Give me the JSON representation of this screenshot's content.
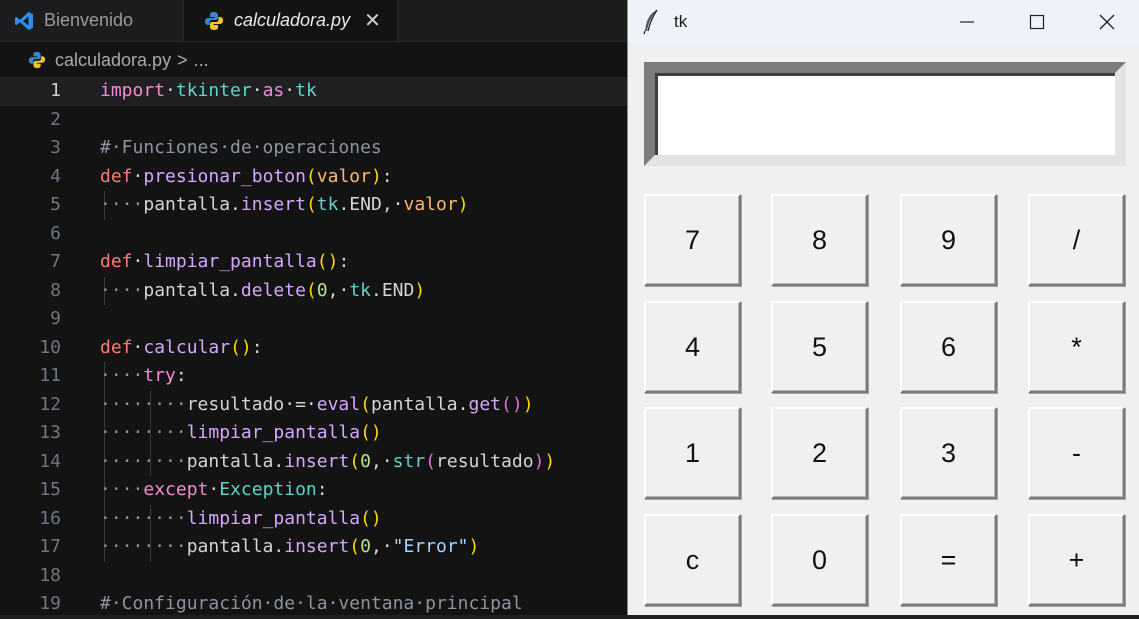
{
  "editor": {
    "tabs": [
      {
        "label": "Bienvenido",
        "icon": "vscode-logo-icon"
      },
      {
        "label": "calculadora.py",
        "icon": "python-icon",
        "close": "✕"
      }
    ],
    "breadcrumb": {
      "file": "calculadora.py",
      "sep": ">",
      "more": "..."
    },
    "lines": [
      {
        "n": "1",
        "indent": 0,
        "toks": [
          [
            "kw",
            "import"
          ],
          [
            "",
            "·"
          ],
          [
            "mod",
            "tkinter"
          ],
          [
            "",
            "·"
          ],
          [
            "kw",
            "as"
          ],
          [
            "",
            "·"
          ],
          [
            "mod",
            "tk"
          ]
        ]
      },
      {
        "n": "2",
        "indent": 0,
        "toks": []
      },
      {
        "n": "3",
        "indent": 0,
        "toks": [
          [
            "cm",
            "#·Funciones·de·operaciones"
          ]
        ]
      },
      {
        "n": "4",
        "indent": 0,
        "toks": [
          [
            "kw2",
            "def"
          ],
          [
            "",
            "·"
          ],
          [
            "fn",
            "presionar_boton"
          ],
          [
            "br1",
            "("
          ],
          [
            "par",
            "valor"
          ],
          [
            "br1",
            ")"
          ],
          [
            "",
            ":"
          ]
        ]
      },
      {
        "n": "5",
        "indent": 1,
        "toks": [
          [
            "cm",
            "····"
          ],
          [
            "",
            "pantalla."
          ],
          [
            "fn",
            "insert"
          ],
          [
            "br1",
            "("
          ],
          [
            "mod",
            "tk"
          ],
          [
            "",
            ".END,·"
          ],
          [
            "par",
            "valor"
          ],
          [
            "br1",
            ")"
          ]
        ]
      },
      {
        "n": "6",
        "indent": 0,
        "toks": []
      },
      {
        "n": "7",
        "indent": 0,
        "toks": [
          [
            "kw2",
            "def"
          ],
          [
            "",
            "·"
          ],
          [
            "fn",
            "limpiar_pantalla"
          ],
          [
            "br1",
            "()"
          ],
          [
            "",
            ":"
          ]
        ]
      },
      {
        "n": "8",
        "indent": 1,
        "toks": [
          [
            "cm",
            "····"
          ],
          [
            "",
            "pantalla."
          ],
          [
            "fn",
            "delete"
          ],
          [
            "br1",
            "("
          ],
          [
            "num",
            "0"
          ],
          [
            "",
            ",·"
          ],
          [
            "mod",
            "tk"
          ],
          [
            "",
            ".END"
          ],
          [
            "br1",
            ")"
          ]
        ]
      },
      {
        "n": "9",
        "indent": 0,
        "toks": []
      },
      {
        "n": "10",
        "indent": 0,
        "toks": [
          [
            "kw2",
            "def"
          ],
          [
            "",
            "·"
          ],
          [
            "fn",
            "calcular"
          ],
          [
            "br1",
            "()"
          ],
          [
            "",
            ":"
          ]
        ]
      },
      {
        "n": "11",
        "indent": 1,
        "toks": [
          [
            "cm",
            "····"
          ],
          [
            "kw",
            "try"
          ],
          [
            "",
            ":"
          ]
        ]
      },
      {
        "n": "12",
        "indent": 2,
        "toks": [
          [
            "cm",
            "········"
          ],
          [
            "",
            "resultado·=·"
          ],
          [
            "fn",
            "eval"
          ],
          [
            "br1",
            "("
          ],
          [
            "",
            "pantalla."
          ],
          [
            "fn",
            "get"
          ],
          [
            "br2",
            "()"
          ],
          [
            "br1",
            ")"
          ]
        ]
      },
      {
        "n": "13",
        "indent": 2,
        "toks": [
          [
            "cm",
            "········"
          ],
          [
            "fn",
            "limpiar_pantalla"
          ],
          [
            "br1",
            "()"
          ]
        ]
      },
      {
        "n": "14",
        "indent": 2,
        "toks": [
          [
            "cm",
            "········"
          ],
          [
            "",
            "pantalla."
          ],
          [
            "fn",
            "insert"
          ],
          [
            "br1",
            "("
          ],
          [
            "num",
            "0"
          ],
          [
            "",
            ",·"
          ],
          [
            "mod",
            "str"
          ],
          [
            "br2",
            "("
          ],
          [
            "",
            "resultado"
          ],
          [
            "br2",
            ")"
          ],
          [
            "br1",
            ")"
          ]
        ]
      },
      {
        "n": "15",
        "indent": 1,
        "toks": [
          [
            "cm",
            "····"
          ],
          [
            "kw",
            "except"
          ],
          [
            "",
            "·"
          ],
          [
            "mod",
            "Exception"
          ],
          [
            "",
            ":"
          ]
        ]
      },
      {
        "n": "16",
        "indent": 2,
        "toks": [
          [
            "cm",
            "········"
          ],
          [
            "fn",
            "limpiar_pantalla"
          ],
          [
            "br1",
            "()"
          ]
        ]
      },
      {
        "n": "17",
        "indent": 2,
        "toks": [
          [
            "cm",
            "········"
          ],
          [
            "",
            "pantalla."
          ],
          [
            "fn",
            "insert"
          ],
          [
            "br1",
            "("
          ],
          [
            "num",
            "0"
          ],
          [
            "",
            ",·"
          ],
          [
            "str",
            "\"Error\""
          ],
          [
            "br1",
            ")"
          ]
        ]
      },
      {
        "n": "18",
        "indent": 0,
        "toks": []
      },
      {
        "n": "19",
        "indent": 0,
        "toks": [
          [
            "cm",
            "#·Configuración·de·la·ventana·principal"
          ]
        ]
      }
    ]
  },
  "tk_window": {
    "title": "tk",
    "icon": "tk-feather-icon",
    "controls": {
      "minimize": "minimize-icon",
      "maximize": "maximize-icon",
      "close": "close-icon"
    },
    "display_value": "",
    "buttons": [
      [
        "7",
        "8",
        "9",
        "/"
      ],
      [
        "4",
        "5",
        "6",
        "*"
      ],
      [
        "1",
        "2",
        "3",
        "-"
      ],
      [
        "c",
        "0",
        "=",
        "+"
      ]
    ]
  },
  "colors": {
    "editor_bg": "#131314",
    "tk_bg": "#f0f0f0",
    "keyword": "#f18cd5",
    "def": "#ff7b72",
    "function": "#d6a7ff"
  }
}
